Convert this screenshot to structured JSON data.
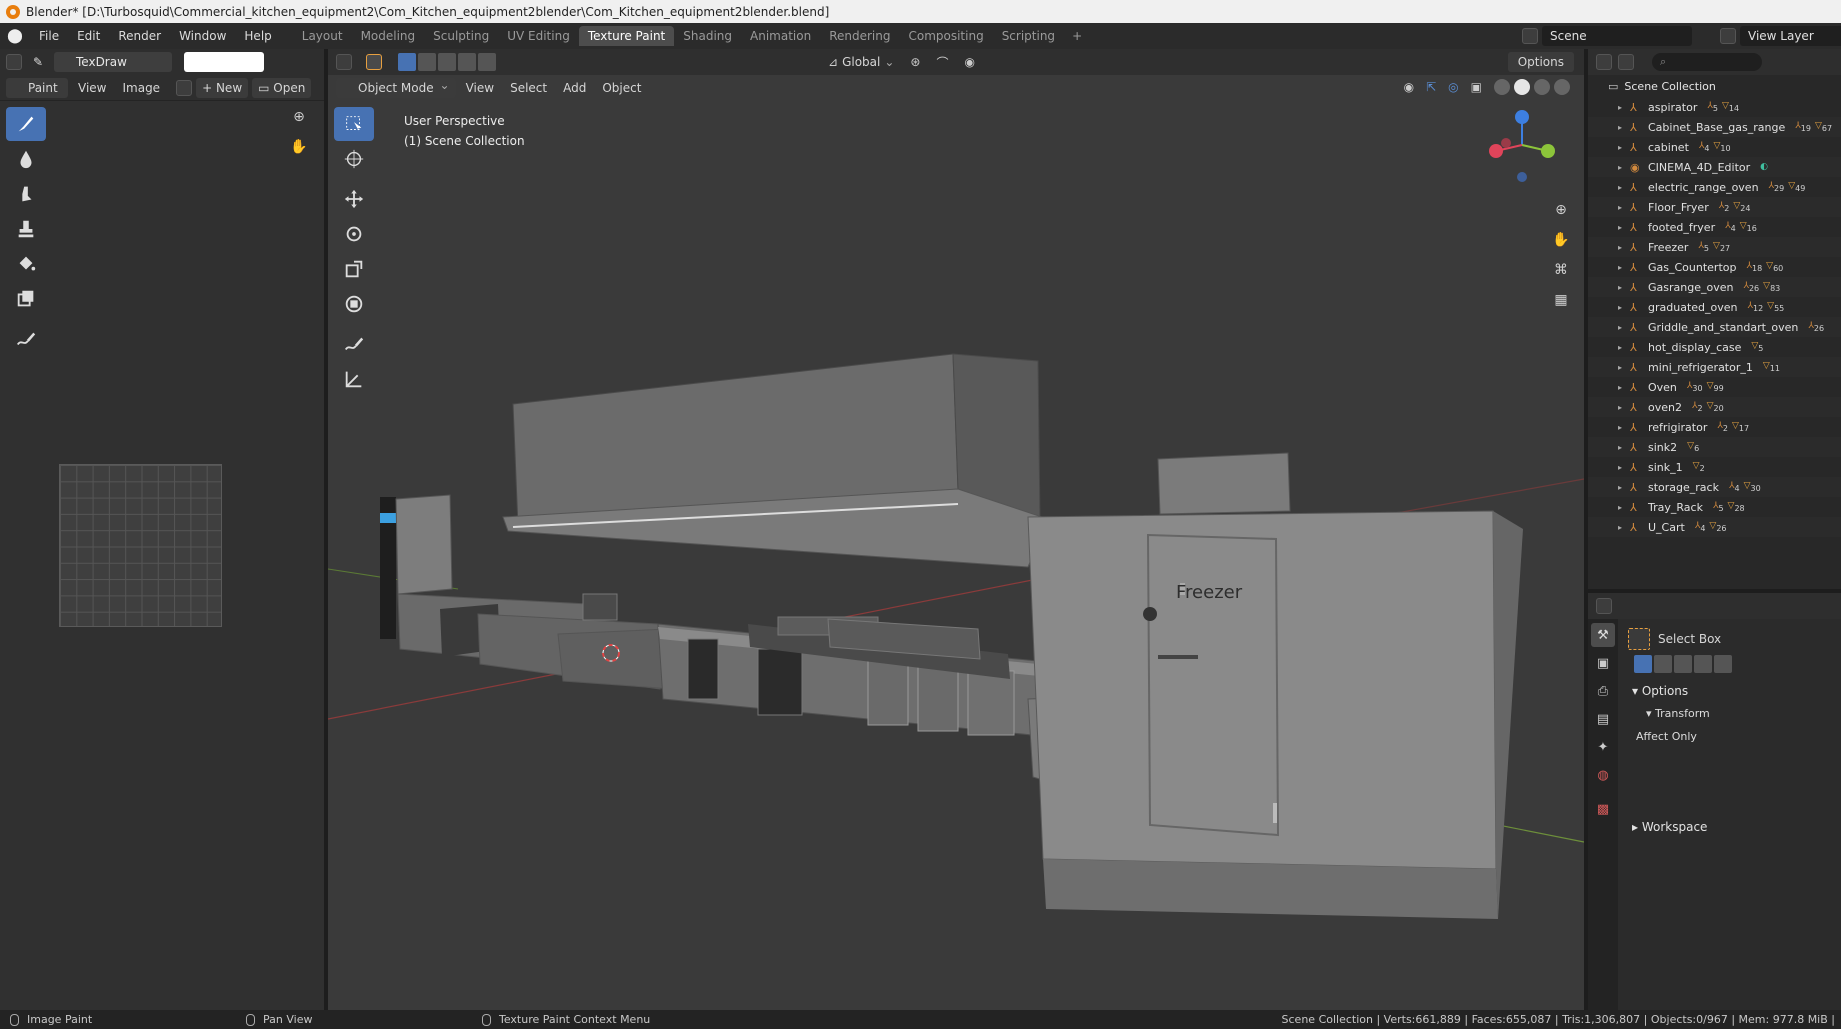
{
  "window": {
    "title": "Blender* [D:\\Turbosquid\\Commercial_kitchen_equipment2\\Com_Kitchen_equipment2blender\\Com_Kitchen_equipment2blender.blend]"
  },
  "menu": {
    "items": [
      "File",
      "Edit",
      "Render",
      "Window",
      "Help"
    ]
  },
  "workspaces": {
    "tabs": [
      "Layout",
      "Modeling",
      "Sculpting",
      "UV Editing",
      "Texture Paint",
      "Shading",
      "Animation",
      "Rendering",
      "Compositing",
      "Scripting"
    ],
    "active": "Texture Paint"
  },
  "scene": {
    "name": "Scene",
    "view_layer": "View Layer"
  },
  "image_editor": {
    "brush_name": "TexDraw",
    "mode": "Paint",
    "menus": [
      "View",
      "Image"
    ],
    "new_label": "New",
    "open_label": "Open"
  },
  "viewport": {
    "mode": "Object Mode",
    "menus": [
      "View",
      "Select",
      "Add",
      "Object"
    ],
    "orientation": "Global",
    "options_label": "Options",
    "perspective": "User Perspective",
    "collection_label": "(1) Scene Collection",
    "freezer_label": "Freezer"
  },
  "outliner": {
    "root": "Scene Collection",
    "items": [
      {
        "name": "aspirator",
        "a": "5",
        "m": "14"
      },
      {
        "name": "Cabinet_Base_gas_range",
        "a": "19",
        "m": "67"
      },
      {
        "name": "cabinet",
        "a": "4",
        "m": "10"
      },
      {
        "name": "CINEMA_4D_Editor",
        "a": "",
        "m": "",
        "camera": true
      },
      {
        "name": "electric_range_oven",
        "a": "29",
        "m": "49"
      },
      {
        "name": "Floor_Fryer",
        "a": "2",
        "m": "24"
      },
      {
        "name": "footed_fryer",
        "a": "4",
        "m": "16"
      },
      {
        "name": "Freezer",
        "a": "5",
        "m": "27"
      },
      {
        "name": "Gas_Countertop",
        "a": "18",
        "m": "60"
      },
      {
        "name": "Gasrange_oven",
        "a": "26",
        "m": "83"
      },
      {
        "name": "graduated_oven",
        "a": "12",
        "m": "55"
      },
      {
        "name": "Griddle_and_standart_oven",
        "a": "26",
        "m": ""
      },
      {
        "name": "hot_display_case",
        "a": "",
        "m": "5"
      },
      {
        "name": "mini_refrigerator_1",
        "a": "",
        "m": "11"
      },
      {
        "name": "Oven",
        "a": "30",
        "m": "99"
      },
      {
        "name": "oven2",
        "a": "2",
        "m": "20"
      },
      {
        "name": "refrigirator",
        "a": "2",
        "m": "17"
      },
      {
        "name": "sink2",
        "a": "",
        "m": "6"
      },
      {
        "name": "sink_1",
        "a": "",
        "m": "2"
      },
      {
        "name": "storage_rack",
        "a": "4",
        "m": "30"
      },
      {
        "name": "Tray_Rack",
        "a": "5",
        "m": "28"
      },
      {
        "name": "U_Cart",
        "a": "4",
        "m": "26"
      }
    ]
  },
  "properties": {
    "tool_name": "Select Box",
    "options_label": "Options",
    "transform_label": "Transform",
    "affect_only_label": "Affect Only",
    "workspace_label": "Workspace"
  },
  "status": {
    "left": "Image Paint",
    "middle": "Pan View",
    "right": "Texture Paint Context Menu",
    "stats": "Scene Collection | Verts:661,889 | Faces:655,087 | Tris:1,306,807 | Objects:0/967 | Mem: 977.8 MiB |"
  },
  "colors": {
    "accent": "#4772b3",
    "viewport_bg": "#3a3a3a",
    "panel_bg": "#303030"
  }
}
